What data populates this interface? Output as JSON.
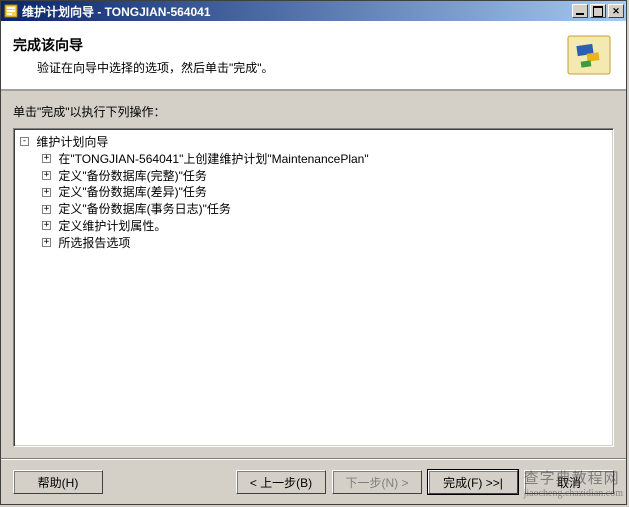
{
  "window": {
    "title": "维护计划向导 - TONGJIAN-564041"
  },
  "header": {
    "title": "完成该向导",
    "subtitle": "验证在向导中选择的选项，然后单击\"完成\"。"
  },
  "content": {
    "label": "单击\"完成\"以执行下列操作：",
    "tree": {
      "root_label": "维护计划向导",
      "items": [
        "在\"TONGJIAN-564041\"上创建维护计划\"MaintenancePlan\"",
        "定义\"备份数据库(完整)\"任务",
        "定义\"备份数据库(差异)\"任务",
        "定义\"备份数据库(事务日志)\"任务",
        "定义维护计划属性。",
        "所选报告选项"
      ]
    }
  },
  "buttons": {
    "help": "帮助(H)",
    "back": "< 上一步(B)",
    "next": "下一步(N) >",
    "finish": "完成(F) >>|",
    "cancel": "取消"
  },
  "watermark": {
    "main": "查字典教程网",
    "sub": "jiaocheng.chazidian.com"
  },
  "colors": {
    "titlebar_start": "#0a246a",
    "titlebar_end": "#a6caf0",
    "face": "#d4d0c8"
  }
}
